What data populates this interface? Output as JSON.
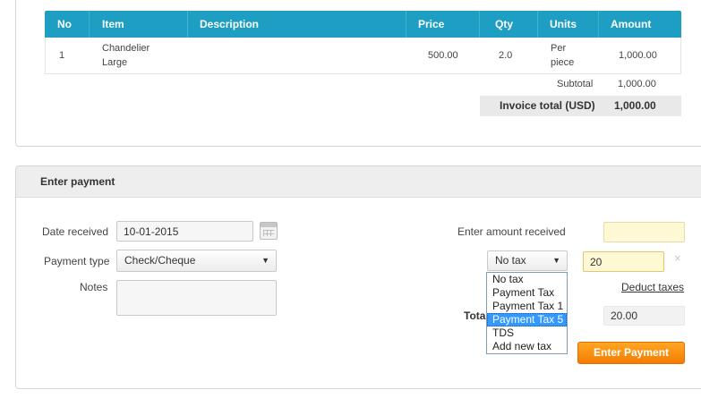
{
  "invoice": {
    "headers": {
      "no": "No",
      "item": "Item",
      "description": "Description",
      "price": "Price",
      "qty": "Qty",
      "units": "Units",
      "amount": "Amount"
    },
    "rows": [
      {
        "no": "1",
        "item_line1": "Chandelier",
        "item_line2": "Large",
        "description": "",
        "price": "500.00",
        "qty": "2.0",
        "units_line1": "Per",
        "units_line2": "piece",
        "amount": "1,000.00"
      }
    ],
    "subtotal_label": "Subtotal",
    "subtotal_value": "1,000.00",
    "total_label": "Invoice total (USD)",
    "total_value": "1,000.00"
  },
  "payment": {
    "header": "Enter payment",
    "date_label": "Date received",
    "date_value": "10-01-2015",
    "payment_type_label": "Payment type",
    "payment_type_value": "Check/Cheque",
    "notes_label": "Notes",
    "notes_value": "",
    "amount_label": "Enter amount received",
    "amount_value": "",
    "tax_select_value": "No tax",
    "tax_amount_value": "20",
    "tax_options": [
      "No tax",
      "Payment Tax",
      "Payment Tax 1",
      "Payment Tax 5",
      "TDS",
      "Add new tax"
    ],
    "tax_selected_index": 3,
    "close_symbol": "×",
    "deduct_taxes_label": "Deduct taxes",
    "total_label": "Total",
    "total_value": "20.00",
    "submit_label": "Enter Payment"
  },
  "colors": {
    "table_header": "#1e9ec2",
    "button": "#f47c00",
    "amount_field": "#fff8d4"
  }
}
